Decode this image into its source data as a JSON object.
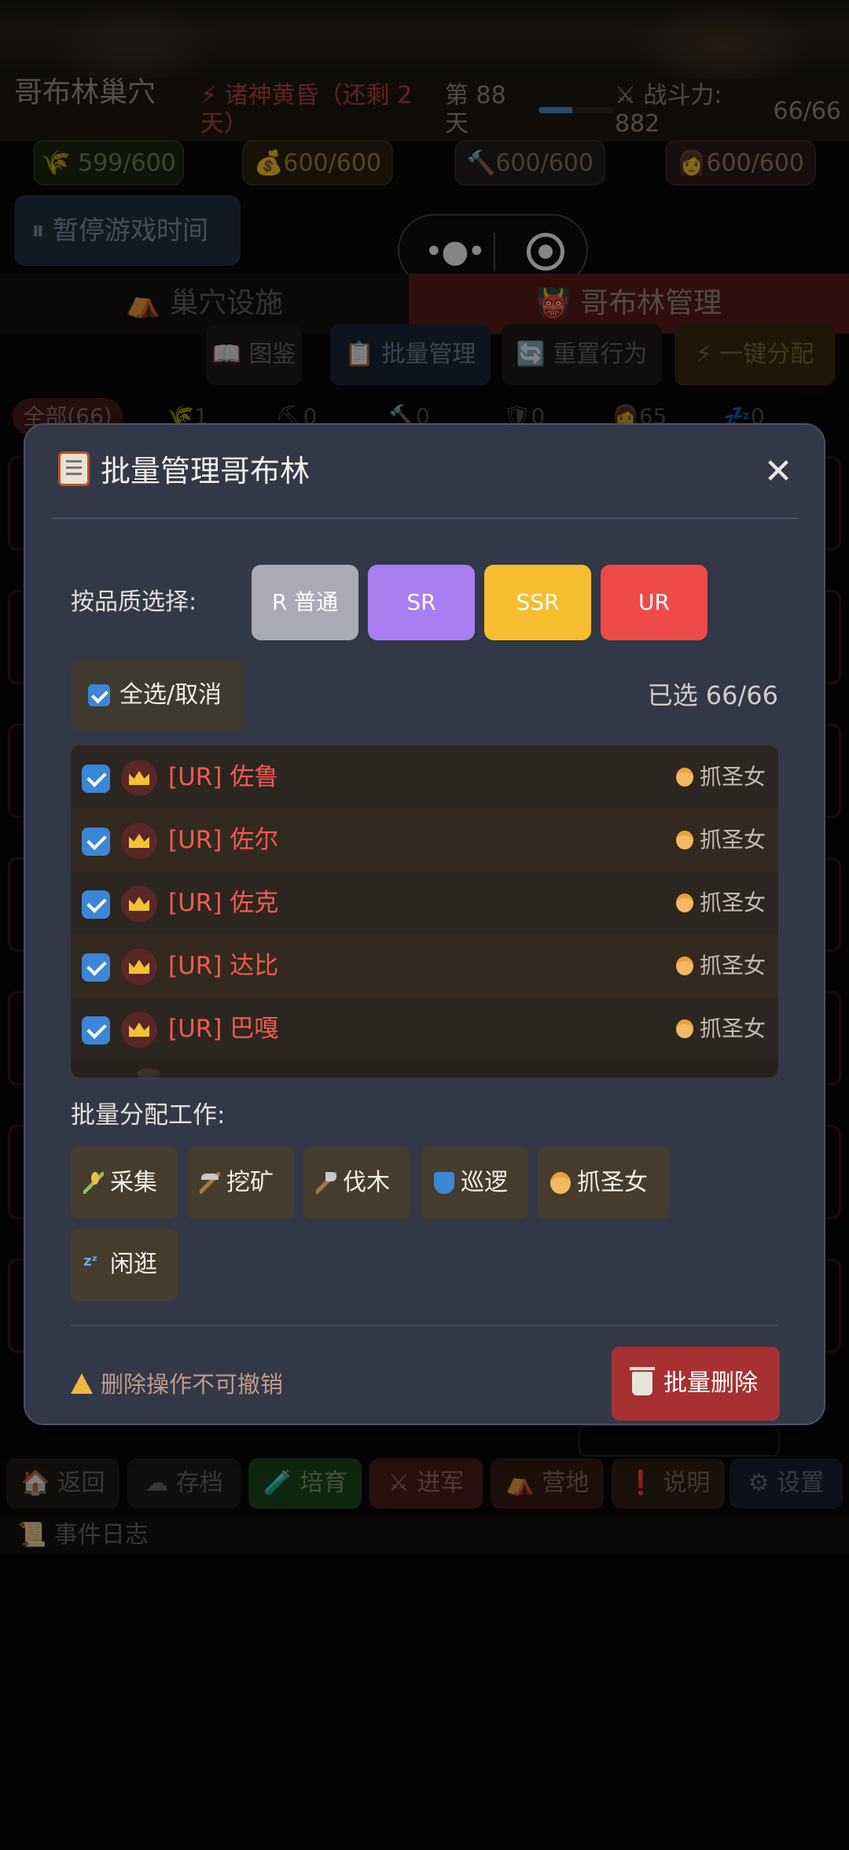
{
  "app": {
    "title": "哥布林巢穴",
    "event": "⚡ 诸神黄昏（还剩 2 天）",
    "day": "第 88 天",
    "day_progress": 0.45,
    "power": "⚔ 战斗力: 882",
    "goblin_count": "66/66"
  },
  "resources": {
    "food": "599/600",
    "gold": "600/600",
    "wood": "600/600",
    "women": "600/600"
  },
  "pause_button": "⏸ 暂停游戏时间",
  "main_tabs": {
    "nest": "⛺ 巢穴设施",
    "goblin": "👹 哥布林管理"
  },
  "sub_tabs": {
    "book": "📖 图鉴",
    "batch": "📋 批量管理",
    "reset": "🔄 重置行为",
    "auto": "⚡ 一键分配"
  },
  "filters": {
    "all": "全部(66)",
    "food": "🌾1",
    "mine": "⛏0",
    "wood": "🔨0",
    "patrol": "🛡0",
    "capture": "👩65",
    "idle": "💤0"
  },
  "bottom_nav": {
    "back": "🏠 返回",
    "save": "☁ 存档",
    "train": "🧪 培育",
    "march": "⚔ 进军",
    "camp": "⛺ 营地",
    "help": "❗ 说明",
    "settings": "⚙ 设置"
  },
  "event_log": "📜 事件日志",
  "modal": {
    "title": "批量管理哥布林",
    "close": "✕",
    "quality_label": "按品质选择:",
    "quality_buttons": {
      "r": "R 普通",
      "sr": "SR",
      "ssr": "SSR",
      "ur": "UR"
    },
    "select_all": "全选/取消",
    "selected_count": "已选 66/66",
    "goblins": [
      {
        "name": "[UR] 佐鲁",
        "job": "抓圣女"
      },
      {
        "name": "[UR] 佐尔",
        "job": "抓圣女"
      },
      {
        "name": "[UR] 佐克",
        "job": "抓圣女"
      },
      {
        "name": "[UR] 达比",
        "job": "抓圣女"
      },
      {
        "name": "[UR] 巴嘎",
        "job": "抓圣女"
      }
    ],
    "job_label": "批量分配工作:",
    "jobs": {
      "gather": "采集",
      "mine": "挖矿",
      "lumber": "伐木",
      "patrol": "巡逻",
      "capture": "抓圣女",
      "idle": "闲逛"
    },
    "warning": "删除操作不可撤销",
    "delete_button": "批量删除"
  },
  "colors": {
    "modal_bg": "#323848",
    "ur_red": "#ee4a4a",
    "sr_purple": "#a87ef0",
    "ssr_gold": "#f6be2f",
    "r_gray": "#a9aab6",
    "checkbox_blue": "#3b86d6",
    "delete_red": "#a73030"
  }
}
